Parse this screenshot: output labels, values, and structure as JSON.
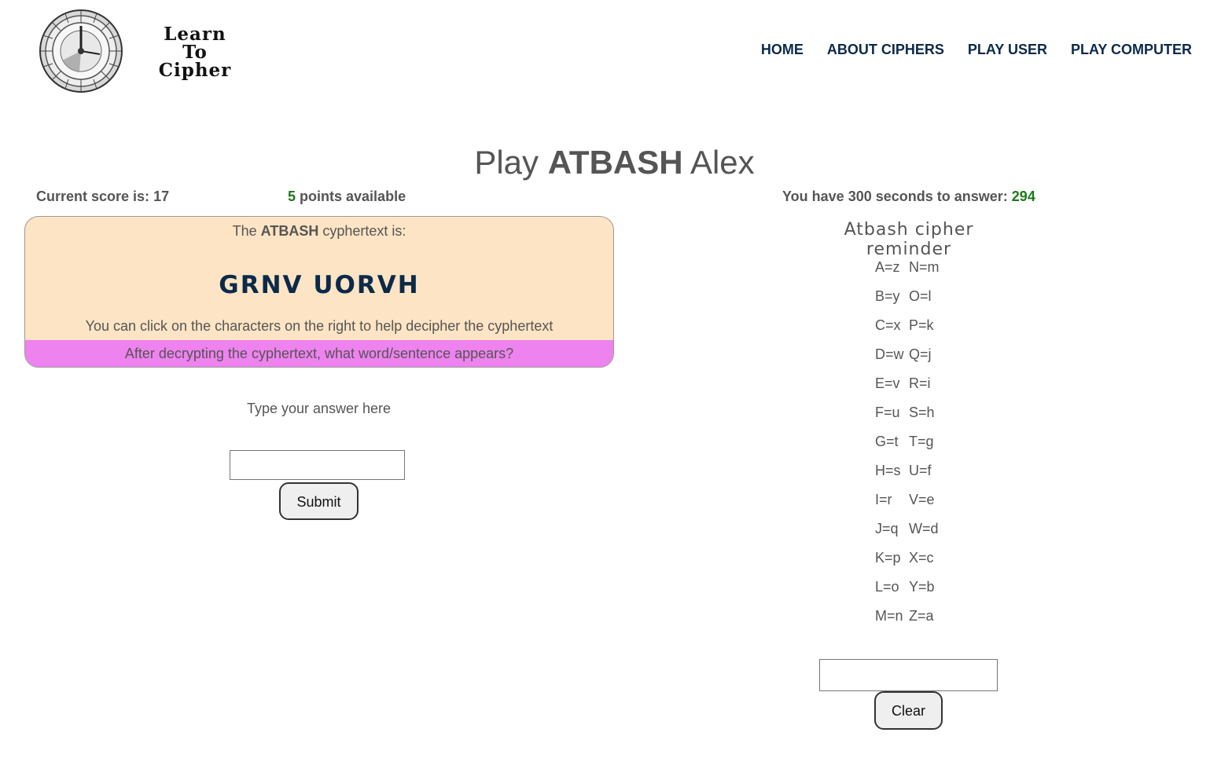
{
  "header": {
    "logo_lines": [
      "Learn",
      "To",
      "Cipher"
    ],
    "nav": [
      "HOME",
      "ABOUT CIPHERS",
      "PLAY USER",
      "PLAY COMPUTER"
    ]
  },
  "title": {
    "prefix": "Play",
    "cipher": "ATBASH",
    "user": "Alex"
  },
  "score": {
    "label": "Current score is:",
    "value": "17"
  },
  "points": {
    "value": "5",
    "label": "points available"
  },
  "timer": {
    "label": "You have 300 seconds to answer:",
    "remaining": "294"
  },
  "cipher_box": {
    "label_prefix": "The",
    "label_cipher": "ATBASH",
    "label_suffix": "cyphertext is:",
    "cyphertext": "GRNV UORVH",
    "hint": "You can click on the characters on the right to help decipher the cyphertext",
    "question": "After decrypting the cyphertext, what word/sentence appears?"
  },
  "answer": {
    "label": "Type your answer here",
    "value": "",
    "submit_label": "Submit"
  },
  "reminder": {
    "title": "Atbash cipher reminder",
    "rows": [
      [
        "A=z",
        "N=m"
      ],
      [
        "B=y",
        "O=l"
      ],
      [
        "C=x",
        "P=k"
      ],
      [
        "D=w",
        "Q=j"
      ],
      [
        "E=v",
        "R=i"
      ],
      [
        "F=u",
        "S=h"
      ],
      [
        "G=t",
        "T=g"
      ],
      [
        "H=s",
        "U=f"
      ],
      [
        "I=r",
        "V=e"
      ],
      [
        "J=q",
        "W=d"
      ],
      [
        "K=p",
        "X=c"
      ],
      [
        "L=o",
        "Y=b"
      ],
      [
        "M=n",
        "Z=a"
      ]
    ],
    "input_value": "",
    "clear_label": "Clear"
  },
  "colors": {
    "nav": "#0b2a4a",
    "cipher_box_bg": "#fde4c4",
    "question_bg": "#ee82ee",
    "highlight_green": "#1a7a1a"
  },
  "icons": {
    "logo": "cipher-wheel-icon"
  }
}
